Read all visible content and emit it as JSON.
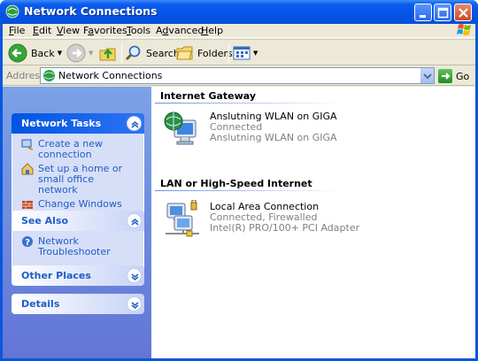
{
  "window": {
    "title": "Network Connections"
  },
  "menu": {
    "items": [
      "File",
      "Edit",
      "View",
      "Favorites",
      "Tools",
      "Advanced",
      "Help"
    ],
    "mnemonics": [
      "F",
      "E",
      "V",
      "a",
      "T",
      "d",
      "H"
    ]
  },
  "toolbar": {
    "back_label": "Back",
    "search_label": "Search",
    "folders_label": "Folders"
  },
  "address": {
    "label": "Address",
    "value": "Network Connections",
    "go_label": "Go"
  },
  "taskpane": {
    "network_tasks": {
      "title": "Network Tasks",
      "items": [
        {
          "label": "Create a new connection",
          "icon": "new-connection-icon"
        },
        {
          "label": "Set up a home or small office network",
          "icon": "home-network-icon"
        },
        {
          "label": "Change Windows Firewall settings",
          "icon": "firewall-icon"
        }
      ]
    },
    "see_also": {
      "title": "See Also",
      "items": [
        {
          "label": "Network Troubleshooter",
          "icon": "help-icon"
        }
      ]
    },
    "other_places": {
      "title": "Other Places"
    },
    "details": {
      "title": "Details"
    }
  },
  "content": {
    "groups": [
      {
        "title": "Internet Gateway",
        "connections": [
          {
            "name": "Anslutning WLAN on GIGA",
            "status": "Connected",
            "device": "Anslutning WLAN on GIGA",
            "icon": "internet-gateway-icon"
          }
        ]
      },
      {
        "title": "LAN or High-Speed Internet",
        "connections": [
          {
            "name": "Local Area Connection",
            "status": "Connected, Firewalled",
            "device": "Intel(R) PRO/100+ PCI Adapter",
            "icon": "lan-connection-icon"
          }
        ]
      }
    ]
  },
  "colors": {
    "titlebar": "#0553e6",
    "taskpane_top": "#7ba2e7",
    "taskpane_bottom": "#6375d6",
    "link": "#215dc6"
  }
}
